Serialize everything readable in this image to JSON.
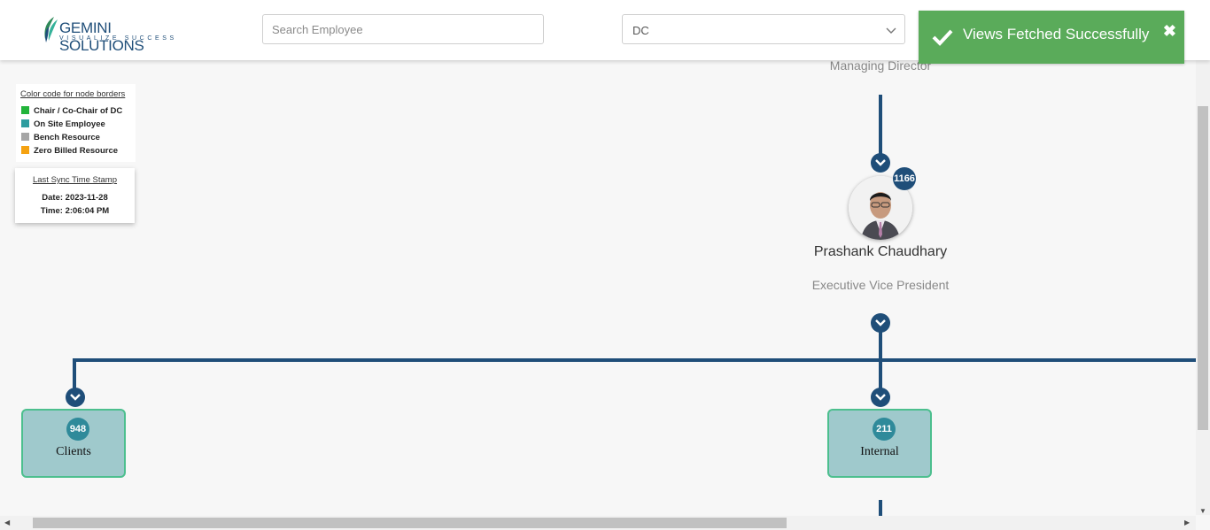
{
  "header": {
    "logo": {
      "main_text": "GEMINI SOLUTIONS",
      "tagline": "VISUALIZE SUCCESS",
      "icon": "leaf-logo-icon"
    },
    "search": {
      "placeholder": "Search Employee",
      "value": ""
    },
    "dropdown": {
      "value": "DC",
      "icon": "chevron-down-icon"
    }
  },
  "toast": {
    "message": "Views Fetched Successfully",
    "icon": "checkmark-icon",
    "close_glyph": "✖",
    "color": "#5aab5a"
  },
  "legend": {
    "title": "Color code for node borders",
    "items": [
      {
        "label": "Chair / Co-Chair of DC",
        "color": "#22b43a"
      },
      {
        "label": "On Site Employee",
        "color": "#2e9d9f"
      },
      {
        "label": "Bench Resource",
        "color": "#a6a6a6"
      },
      {
        "label": "Zero Billed Resource",
        "color": "#f5a211"
      }
    ]
  },
  "sync": {
    "title": "Last Sync Time Stamp",
    "date": "Date: 2023-11-28",
    "time": "Time: 2:06:04 PM"
  },
  "org": {
    "top_role": "Managing Director",
    "person": {
      "name": "Prashank Chaudhary",
      "title": "Executive Vice President",
      "count": "1166"
    },
    "children": [
      {
        "label": "Clients",
        "count": "948"
      },
      {
        "label": "Internal",
        "count": "211"
      }
    ],
    "line_color": "#1f4e79"
  }
}
